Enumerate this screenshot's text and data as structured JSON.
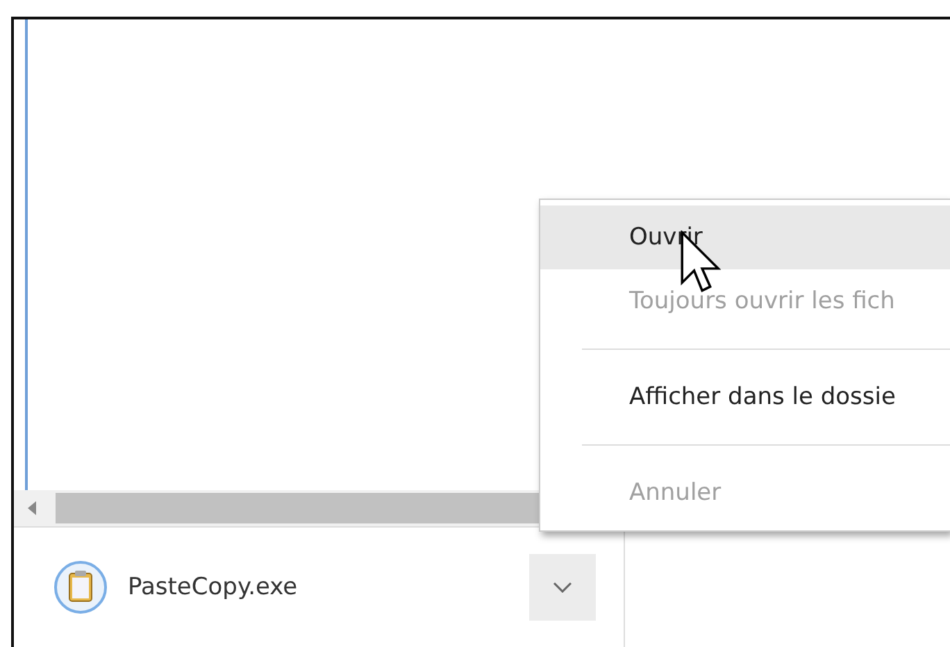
{
  "download": {
    "file_name": "PasteCopy.exe"
  },
  "menu": {
    "items": [
      {
        "kind": "item",
        "label": "Ouvrir",
        "selected": true,
        "disabled": false
      },
      {
        "kind": "item",
        "label": "Toujours ouvrir les fich",
        "selected": false,
        "disabled": true
      },
      {
        "kind": "separator"
      },
      {
        "kind": "item",
        "label": "Afficher dans le dossie",
        "selected": false,
        "disabled": false
      },
      {
        "kind": "separator"
      },
      {
        "kind": "item",
        "label": "Annuler",
        "selected": false,
        "disabled": true
      }
    ]
  }
}
